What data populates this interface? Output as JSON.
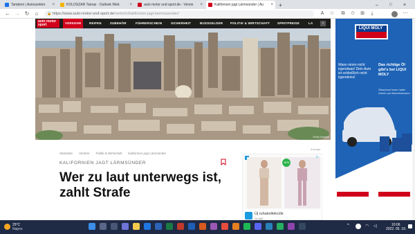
{
  "browser": {
    "tabs": [
      {
        "title": "Tartalom | Autoszektor",
        "color": "#1a73e8"
      },
      {
        "title": "KOLOSZAR Tamas - Outlook Web",
        "color": "#f4b400"
      },
      {
        "title": "auto motor und sport.de - Versio",
        "color": "#d0021b"
      },
      {
        "title": "Kalifornien jagt Lärmsünder | Au",
        "color": "#d0021b"
      }
    ],
    "url_domain": "https://www.auto-motor-und-sport.de",
    "url_path": "/verkehr/kalifornien-jagt-laermsuender/"
  },
  "site": {
    "logo_text": "auto motor sport",
    "nav": [
      "VERKEHR",
      "REIFEN",
      "ZUBEHÖR",
      "FÜHRERSCHEIN",
      "SICHERHEIT",
      "BUSSGELDER",
      "POLITIK & WIRTSCHAFT",
      "SPRITPREISE",
      "LA"
    ],
    "nav_active": "POLITIK & WIRTSCHAFT",
    "photo_credit": "Getty Images"
  },
  "article": {
    "breadcrumb": [
      "Startseite",
      "Verkehr",
      "Politik & Wirtschaft",
      "Kalifornien jagt Lärmsünder"
    ],
    "kicker": "KALIFORNIEN JAGT LÄRMSÜNDER",
    "headline": "Wer zu laut unterwegs ist, zahlt Strafe"
  },
  "ads": {
    "label": "Anzeige",
    "inline_caption": "Új ruhakollekciók",
    "inline_brand": "GLAMI",
    "inline_badge": "-30%",
    "right_brand": "LIQUI MOLY",
    "right_tagline": "Das richtige Öl gibt's bei LIQUI MOLY",
    "right_body": "Wann nimm nicht irgendwas! Dein Auto ist schließlich nicht irgendeins!",
    "right_sub": "Ölwechsel kann halbe Arbeit und Betriebskosten"
  },
  "taskbar": {
    "temp": "25°C",
    "weather": "Napos",
    "time": "10:06",
    "date": "2022. 05. 19."
  },
  "colors": {
    "brand_red": "#d0021b",
    "site_nav_bg": "#1d1d1b",
    "taskbar_bg": "#1f2a44"
  }
}
